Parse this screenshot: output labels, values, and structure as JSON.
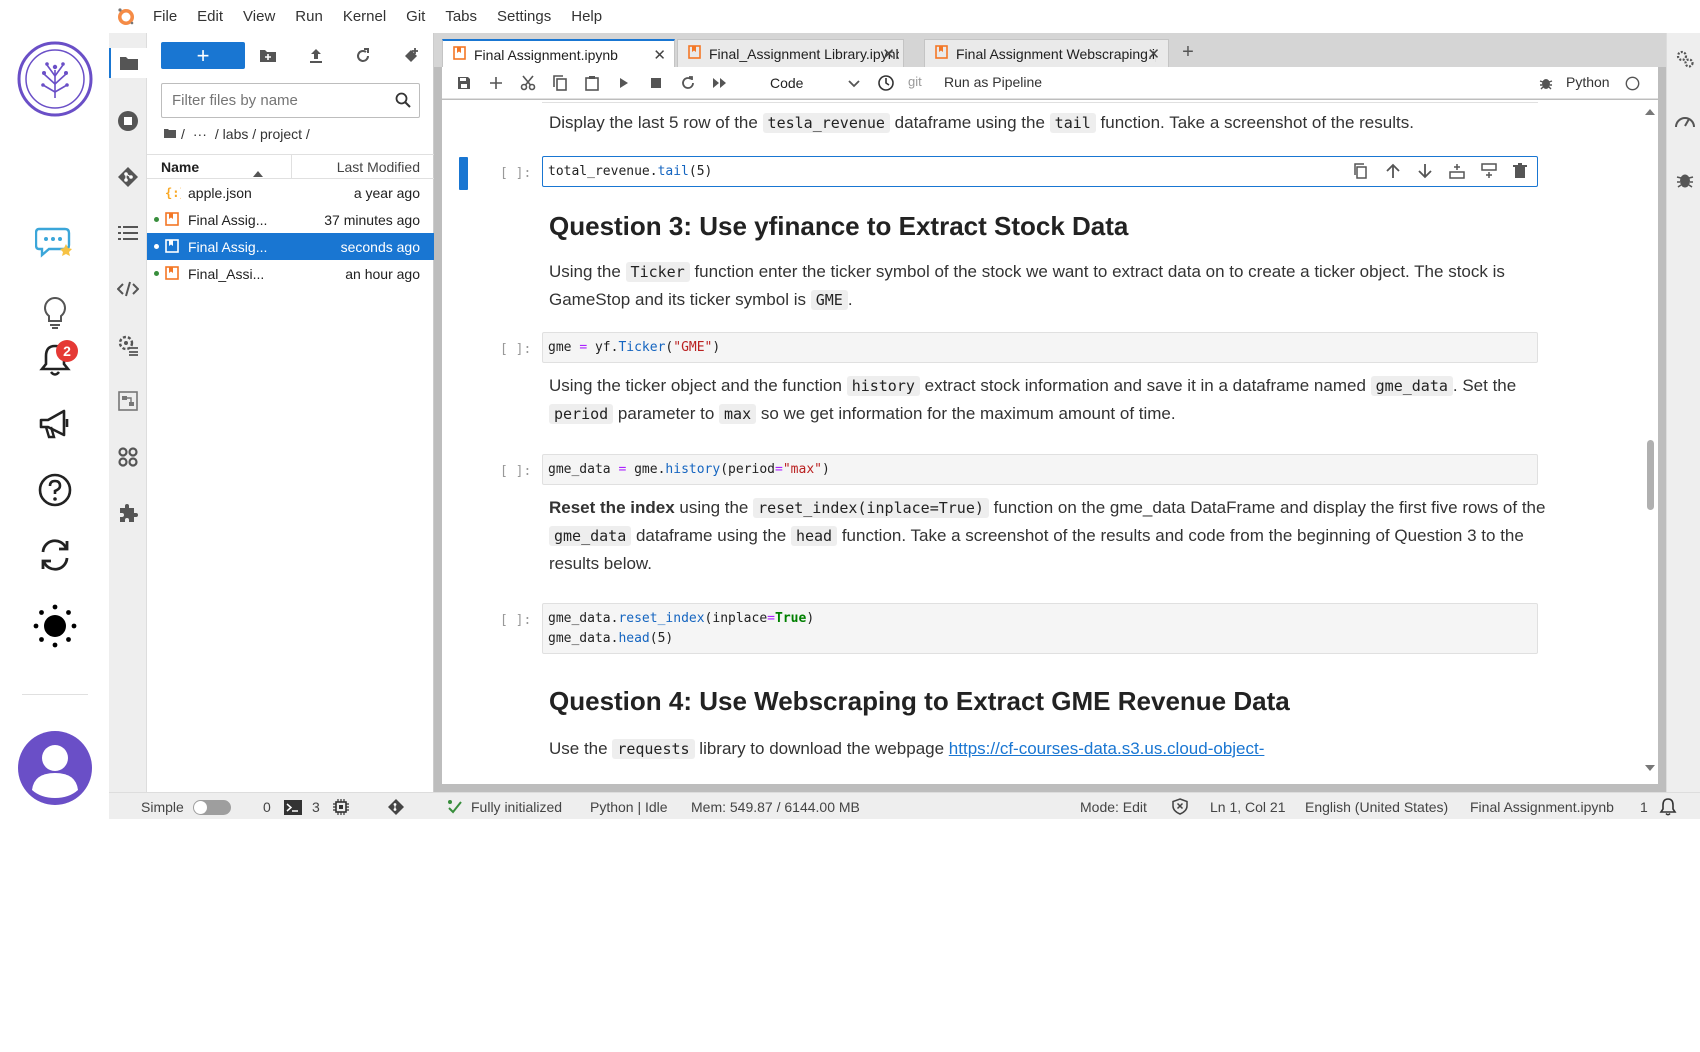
{
  "menu": [
    "File",
    "Edit",
    "View",
    "Run",
    "Kernel",
    "Git",
    "Tabs",
    "Settings",
    "Help"
  ],
  "rail": {
    "notification_count": "2"
  },
  "filebrowser": {
    "new_label": "+",
    "filter_placeholder": "Filter files by name",
    "breadcrumb": [
      "/",
      "···",
      "/ labs / project /"
    ],
    "col_name": "Name",
    "col_modified": "Last Modified",
    "files": [
      {
        "name": "apple.json",
        "modified": "a year ago",
        "running": false,
        "selected": false,
        "kind": "json"
      },
      {
        "name": "Final Assig...",
        "modified": "37 minutes ago",
        "running": true,
        "selected": false,
        "kind": "notebook"
      },
      {
        "name": "Final Assig...",
        "modified": "seconds ago",
        "running": true,
        "selected": true,
        "kind": "notebook"
      },
      {
        "name": "Final_Assi...",
        "modified": "an hour ago",
        "running": true,
        "selected": false,
        "kind": "notebook"
      }
    ]
  },
  "tabs": [
    {
      "label": "Final Assignment.ipynb",
      "active": true
    },
    {
      "label": "Final_Assignment Library.ipynb",
      "active": false
    },
    {
      "label": "Final Assignment Webscraping.ipynb",
      "active": false
    }
  ],
  "toolbar": {
    "cell_type": "Code",
    "git_label": "git",
    "run_pipeline": "Run as Pipeline",
    "kernel_name": "Python"
  },
  "notebook": {
    "md1_pre": "Display the last 5 row of the ",
    "md1_code1": "tesla_revenue",
    "md1_mid": " dataframe using the ",
    "md1_code2": "tail",
    "md1_post": " function. Take a screenshot of the results.",
    "prompt": "[ ]:",
    "cell1": {
      "obj": "total_revenue",
      "method": "tail",
      "arg": "(5)"
    },
    "h_q3": "Question 3: Use yfinance to Extract Stock Data",
    "md2_pre": "Using the ",
    "md2_code1": "Ticker",
    "md2_mid": " function enter the ticker symbol of the stock we want to extract data on to create a ticker object. The stock is GameStop and its ticker symbol is ",
    "md2_code2": "GME",
    "md2_post": ".",
    "cell2": {
      "var": "gme",
      "eq": "=",
      "obj": "yf.",
      "method": "Ticker",
      "open": "(",
      "str": "\"GME\"",
      "close": ")"
    },
    "md3_pre": "Using the ticker object and the function ",
    "md3_code1": "history",
    "md3_mid1": " extract stock information and save it in a dataframe named ",
    "md3_code2": "gme_data",
    "md3_mid2": ". Set the ",
    "md3_code3": "period",
    "md3_mid3": " parameter to ",
    "md3_code4": "max",
    "md3_post": " so we get information for the maximum amount of time.",
    "cell3": {
      "var": "gme_data",
      "eq": "=",
      "obj": "gme.",
      "method": "history",
      "open": "(period",
      "eq2": "=",
      "str": "\"max\"",
      "close": ")"
    },
    "md4_bold": "Reset the index",
    "md4_pre": " using the ",
    "md4_code1": "reset_index(inplace=True)",
    "md4_mid1": " function on the gme_data DataFrame and display the first five rows of the ",
    "md4_code2": "gme_data",
    "md4_mid2": " dataframe using the ",
    "md4_code3": "head",
    "md4_post": " function. Take a screenshot of the results and code from the beginning of Question 3 to the results below.",
    "cell4": {
      "l1_obj": "gme_data.",
      "l1_method": "reset_index",
      "l1_open": "(inplace",
      "l1_eq": "=",
      "l1_bool": "True",
      "l1_close": ")",
      "l2_obj": "gme_data.",
      "l2_method": "head",
      "l2_arg": "(5)"
    },
    "h_q4": "Question 4: Use Webscraping to Extract GME Revenue Data",
    "md5_pre": "Use the ",
    "md5_code": "requests",
    "md5_mid": " library to download the webpage ",
    "md5_link": "https://cf-courses-data.s3.us.cloud-object-"
  },
  "status": {
    "mode_label": "Simple",
    "terminals": "0",
    "kernels": "3",
    "init": "Fully initialized",
    "kernel": "Python | Idle",
    "mem": "Mem: 549.87 / 6144.00 MB",
    "edit_mode": "Mode: Edit",
    "position": "Ln 1, Col 21",
    "language": "English (United States)",
    "file": "Final Assignment.ipynb",
    "notif": "1"
  },
  "colors": {
    "accent": "#1976d2",
    "running": "#388e3c",
    "badge": "#e53935",
    "purple": "#6a4fc7"
  }
}
